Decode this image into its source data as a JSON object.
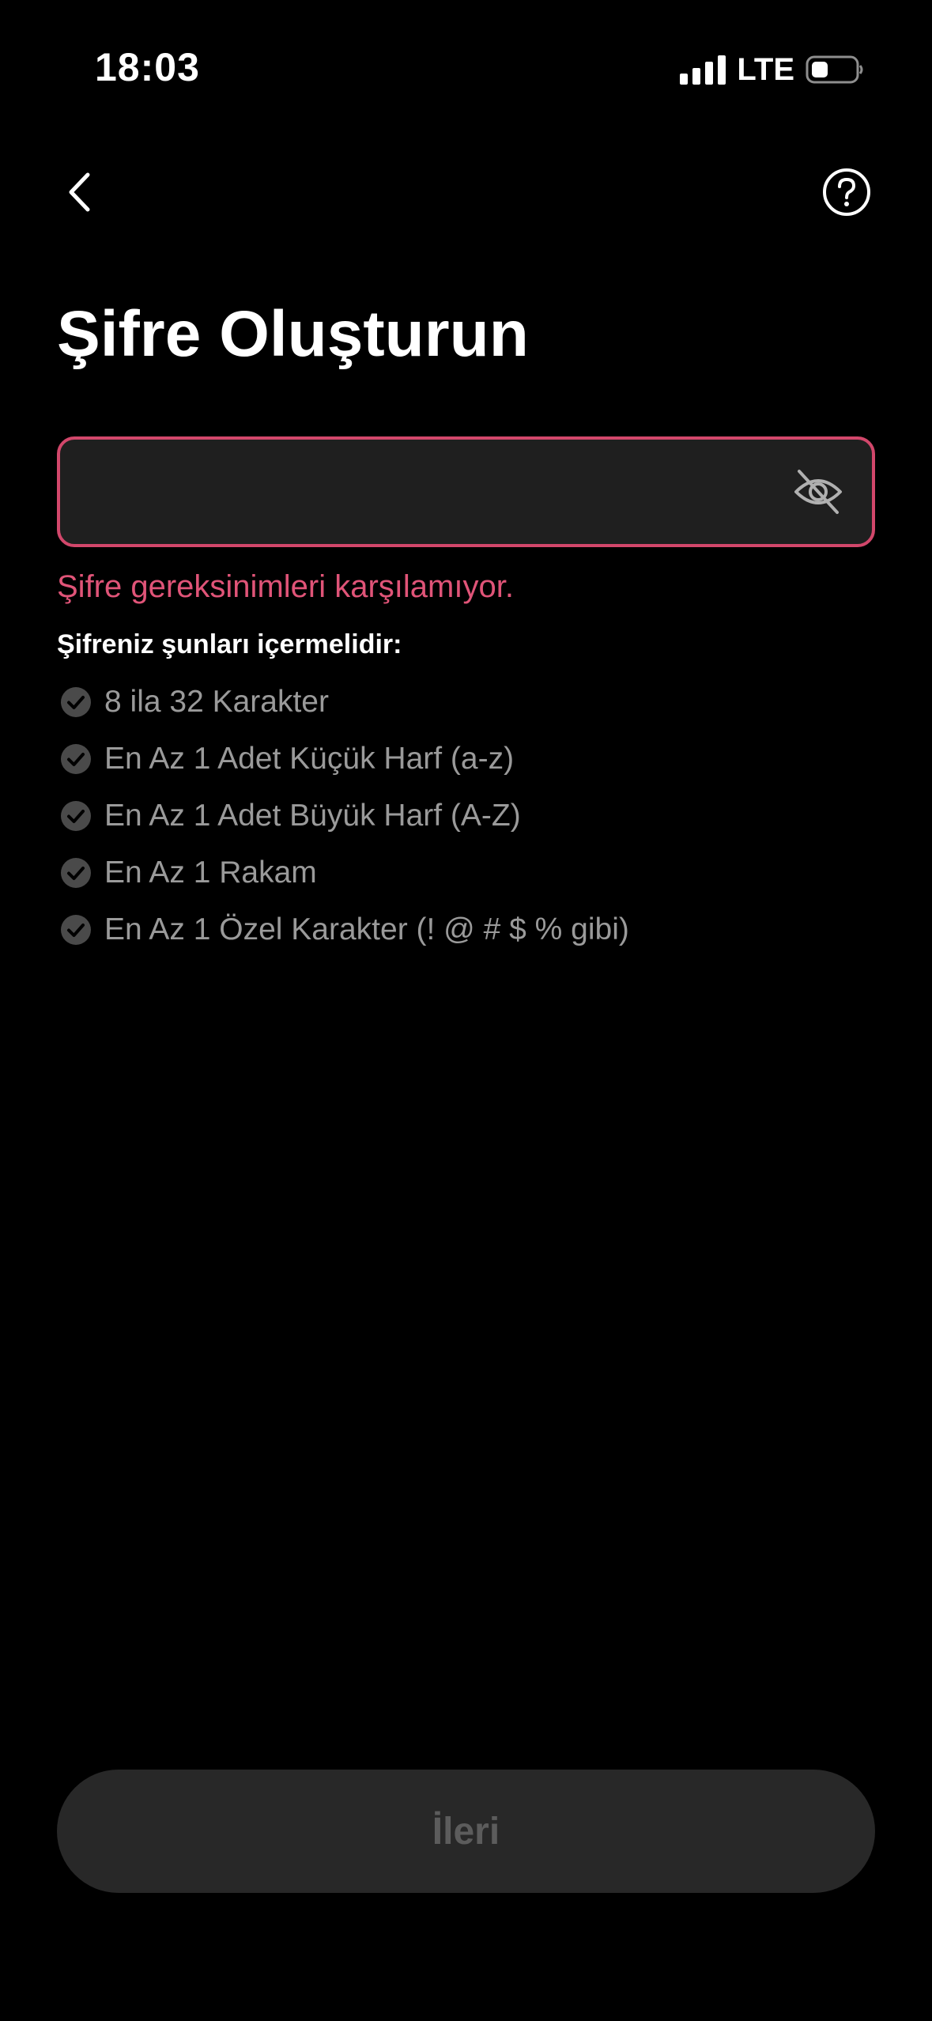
{
  "status_bar": {
    "time": "18:03",
    "network": "LTE"
  },
  "page": {
    "title": "Şifre Oluşturun"
  },
  "password_field": {
    "value": "",
    "placeholder": "",
    "visibility_icon": "eye-slash-icon"
  },
  "validation": {
    "error": "Şifre gereksinimleri karşılamıyor.",
    "requirements_heading": "Şifreniz şunları içermelidir:",
    "requirements": [
      {
        "label": "8 ila 32 Karakter",
        "icon": "check-circle-icon"
      },
      {
        "label": "En Az 1 Adet Küçük Harf (a-z)",
        "icon": "check-circle-icon"
      },
      {
        "label": "En Az 1 Adet Büyük Harf (A-Z)",
        "icon": "check-circle-icon"
      },
      {
        "label": "En Az 1 Rakam",
        "icon": "check-circle-icon"
      },
      {
        "label": "En Az 1 Özel Karakter (! @ # $ % gibi)",
        "icon": "check-circle-icon"
      }
    ]
  },
  "actions": {
    "next_label": "İleri"
  },
  "colors": {
    "background": "#000000",
    "error": "#e05478",
    "field_border_error": "#d2476b",
    "field_bg": "#1f1f1f",
    "requirement_text": "#9a9a9a",
    "button_bg_disabled": "#282828",
    "button_text_disabled": "#5c5c5c"
  }
}
